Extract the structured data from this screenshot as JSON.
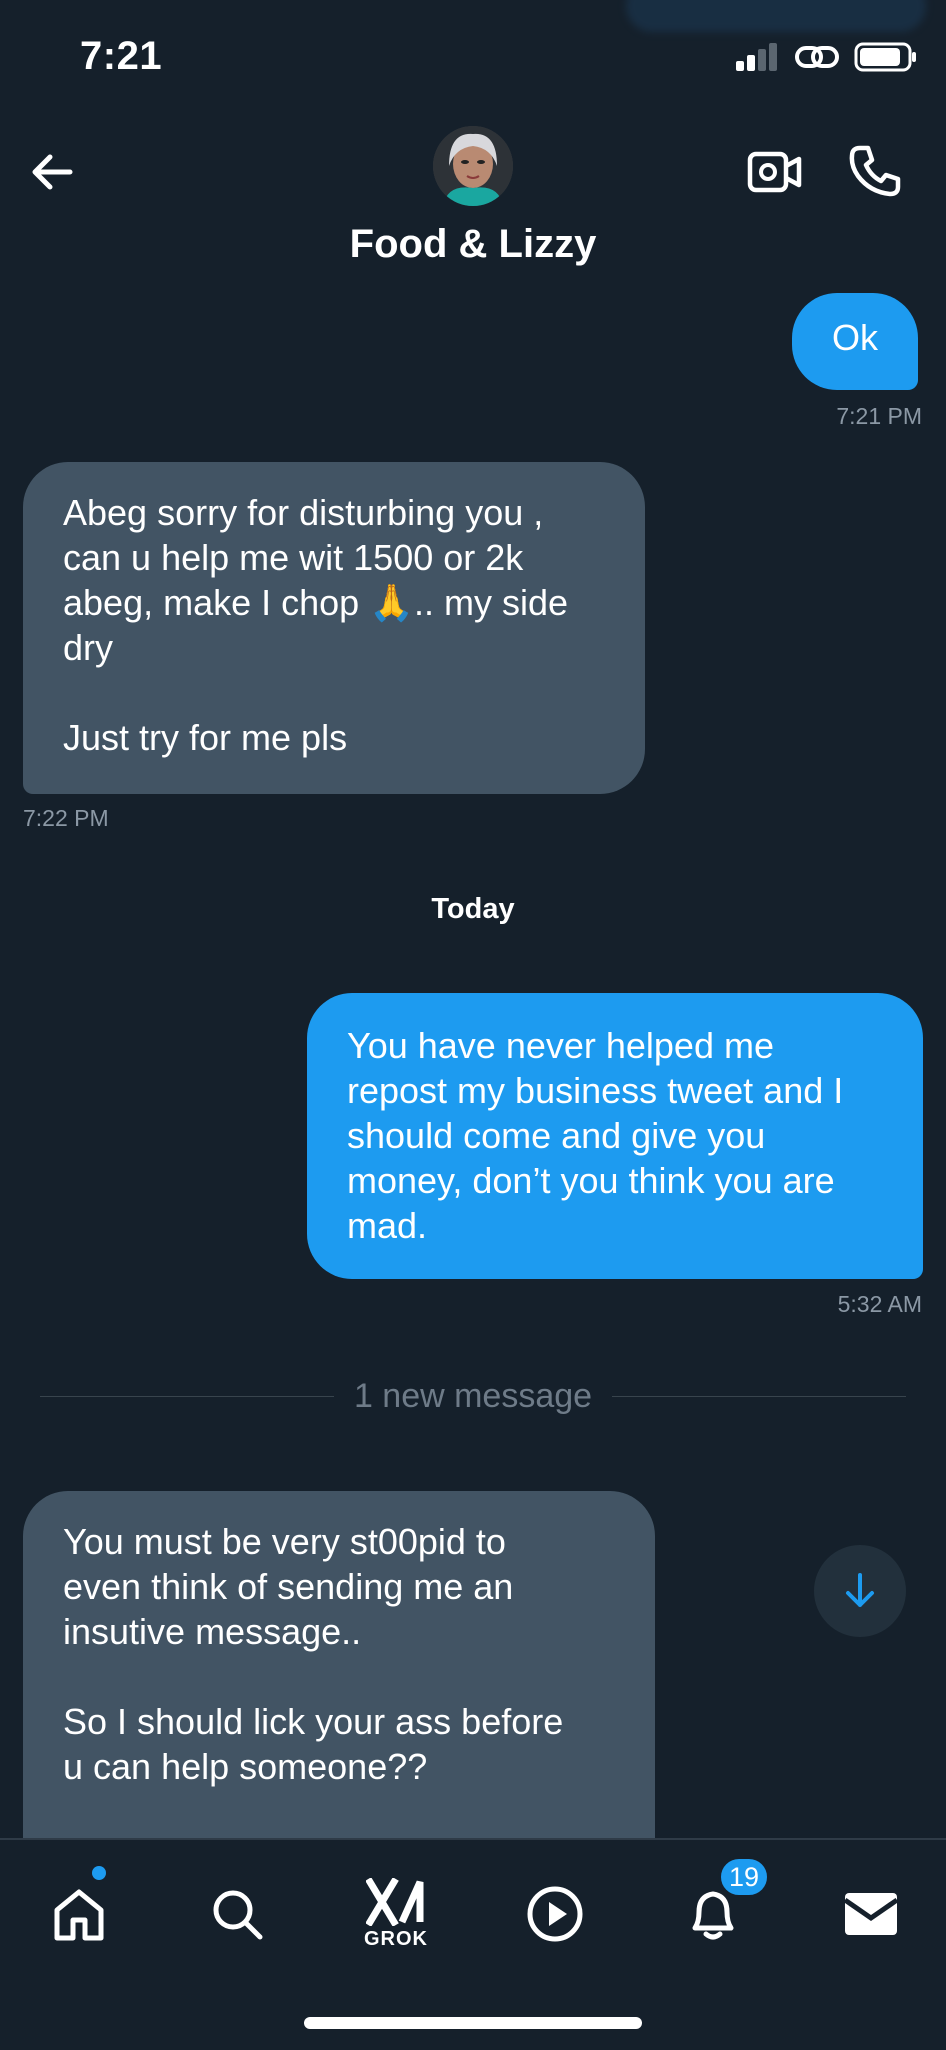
{
  "status_bar": {
    "time": "7:21"
  },
  "header": {
    "contact_name": "Food & Lizzy"
  },
  "messages": [
    {
      "from": "me",
      "text": "Ok",
      "time": "7:21 PM"
    },
    {
      "from": "them",
      "text": "Abeg sorry for disturbing you ,\ncan u help me wit 1500 or 2k\nabeg, make I chop 🙏..  my side\ndry\n\nJust try for me pls",
      "time": "7:22 PM"
    },
    {
      "from": "me",
      "text": "You have never helped me\nrepost my business tweet and I\nshould come and give you\nmoney, don’t you think you are\nmad.",
      "time": "5:32 AM"
    },
    {
      "from": "them",
      "text": "You must be very st00pid to\neven think of sending me an\ninsutive message..\n\nSo I should lick your ass before\nu can help someone??"
    }
  ],
  "day_separator": "Today",
  "new_messages_label": "1 new message",
  "tab_bar": {
    "grok_label": "GROK",
    "notifications_count": "19"
  },
  "colors": {
    "background": "#15202b",
    "sent_bubble": "#1d9bf0",
    "received_bubble": "#425464",
    "accent": "#1d9bf0"
  }
}
